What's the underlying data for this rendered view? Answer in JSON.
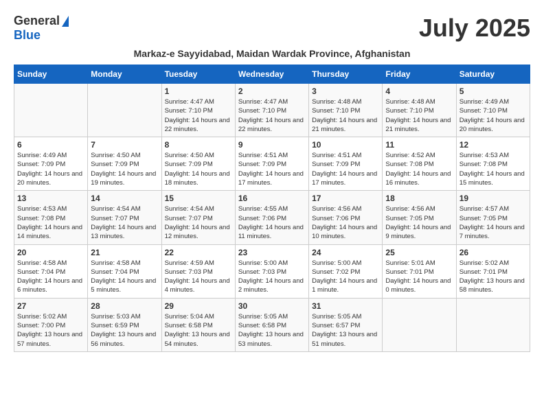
{
  "header": {
    "logo_general": "General",
    "logo_blue": "Blue",
    "month_title": "July 2025",
    "subtitle": "Markaz-e Sayyidabad, Maidan Wardak Province, Afghanistan"
  },
  "days_of_week": [
    "Sunday",
    "Monday",
    "Tuesday",
    "Wednesday",
    "Thursday",
    "Friday",
    "Saturday"
  ],
  "weeks": [
    [
      {
        "day": "",
        "info": ""
      },
      {
        "day": "",
        "info": ""
      },
      {
        "day": "1",
        "info": "Sunrise: 4:47 AM\nSunset: 7:10 PM\nDaylight: 14 hours and 22 minutes."
      },
      {
        "day": "2",
        "info": "Sunrise: 4:47 AM\nSunset: 7:10 PM\nDaylight: 14 hours and 22 minutes."
      },
      {
        "day": "3",
        "info": "Sunrise: 4:48 AM\nSunset: 7:10 PM\nDaylight: 14 hours and 21 minutes."
      },
      {
        "day": "4",
        "info": "Sunrise: 4:48 AM\nSunset: 7:10 PM\nDaylight: 14 hours and 21 minutes."
      },
      {
        "day": "5",
        "info": "Sunrise: 4:49 AM\nSunset: 7:10 PM\nDaylight: 14 hours and 20 minutes."
      }
    ],
    [
      {
        "day": "6",
        "info": "Sunrise: 4:49 AM\nSunset: 7:09 PM\nDaylight: 14 hours and 20 minutes."
      },
      {
        "day": "7",
        "info": "Sunrise: 4:50 AM\nSunset: 7:09 PM\nDaylight: 14 hours and 19 minutes."
      },
      {
        "day": "8",
        "info": "Sunrise: 4:50 AM\nSunset: 7:09 PM\nDaylight: 14 hours and 18 minutes."
      },
      {
        "day": "9",
        "info": "Sunrise: 4:51 AM\nSunset: 7:09 PM\nDaylight: 14 hours and 17 minutes."
      },
      {
        "day": "10",
        "info": "Sunrise: 4:51 AM\nSunset: 7:09 PM\nDaylight: 14 hours and 17 minutes."
      },
      {
        "day": "11",
        "info": "Sunrise: 4:52 AM\nSunset: 7:08 PM\nDaylight: 14 hours and 16 minutes."
      },
      {
        "day": "12",
        "info": "Sunrise: 4:53 AM\nSunset: 7:08 PM\nDaylight: 14 hours and 15 minutes."
      }
    ],
    [
      {
        "day": "13",
        "info": "Sunrise: 4:53 AM\nSunset: 7:08 PM\nDaylight: 14 hours and 14 minutes."
      },
      {
        "day": "14",
        "info": "Sunrise: 4:54 AM\nSunset: 7:07 PM\nDaylight: 14 hours and 13 minutes."
      },
      {
        "day": "15",
        "info": "Sunrise: 4:54 AM\nSunset: 7:07 PM\nDaylight: 14 hours and 12 minutes."
      },
      {
        "day": "16",
        "info": "Sunrise: 4:55 AM\nSunset: 7:06 PM\nDaylight: 14 hours and 11 minutes."
      },
      {
        "day": "17",
        "info": "Sunrise: 4:56 AM\nSunset: 7:06 PM\nDaylight: 14 hours and 10 minutes."
      },
      {
        "day": "18",
        "info": "Sunrise: 4:56 AM\nSunset: 7:05 PM\nDaylight: 14 hours and 9 minutes."
      },
      {
        "day": "19",
        "info": "Sunrise: 4:57 AM\nSunset: 7:05 PM\nDaylight: 14 hours and 7 minutes."
      }
    ],
    [
      {
        "day": "20",
        "info": "Sunrise: 4:58 AM\nSunset: 7:04 PM\nDaylight: 14 hours and 6 minutes."
      },
      {
        "day": "21",
        "info": "Sunrise: 4:58 AM\nSunset: 7:04 PM\nDaylight: 14 hours and 5 minutes."
      },
      {
        "day": "22",
        "info": "Sunrise: 4:59 AM\nSunset: 7:03 PM\nDaylight: 14 hours and 4 minutes."
      },
      {
        "day": "23",
        "info": "Sunrise: 5:00 AM\nSunset: 7:03 PM\nDaylight: 14 hours and 2 minutes."
      },
      {
        "day": "24",
        "info": "Sunrise: 5:00 AM\nSunset: 7:02 PM\nDaylight: 14 hours and 1 minute."
      },
      {
        "day": "25",
        "info": "Sunrise: 5:01 AM\nSunset: 7:01 PM\nDaylight: 14 hours and 0 minutes."
      },
      {
        "day": "26",
        "info": "Sunrise: 5:02 AM\nSunset: 7:01 PM\nDaylight: 13 hours and 58 minutes."
      }
    ],
    [
      {
        "day": "27",
        "info": "Sunrise: 5:02 AM\nSunset: 7:00 PM\nDaylight: 13 hours and 57 minutes."
      },
      {
        "day": "28",
        "info": "Sunrise: 5:03 AM\nSunset: 6:59 PM\nDaylight: 13 hours and 56 minutes."
      },
      {
        "day": "29",
        "info": "Sunrise: 5:04 AM\nSunset: 6:58 PM\nDaylight: 13 hours and 54 minutes."
      },
      {
        "day": "30",
        "info": "Sunrise: 5:05 AM\nSunset: 6:58 PM\nDaylight: 13 hours and 53 minutes."
      },
      {
        "day": "31",
        "info": "Sunrise: 5:05 AM\nSunset: 6:57 PM\nDaylight: 13 hours and 51 minutes."
      },
      {
        "day": "",
        "info": ""
      },
      {
        "day": "",
        "info": ""
      }
    ]
  ]
}
